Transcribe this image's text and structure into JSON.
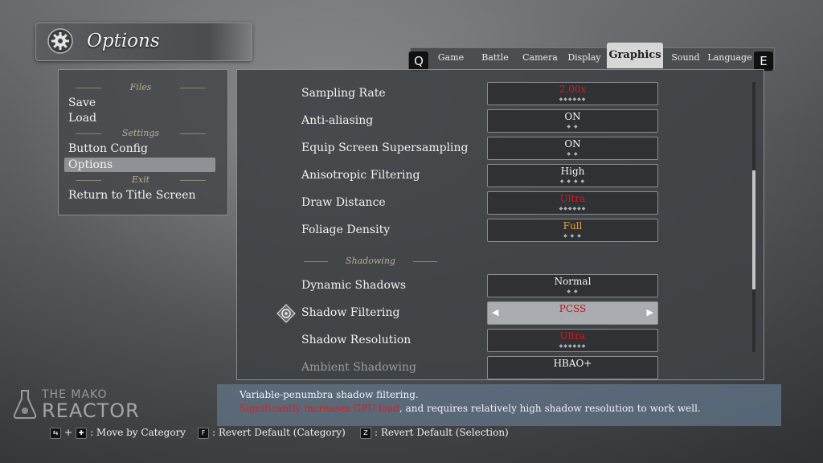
{
  "header": {
    "title": "Options",
    "icon": "gear-icon"
  },
  "tabs": {
    "left_key": "Q",
    "right_key": "E",
    "items": [
      {
        "label": "Game"
      },
      {
        "label": "Battle"
      },
      {
        "label": "Camera"
      },
      {
        "label": "Display"
      },
      {
        "label": "Graphics",
        "active": true
      },
      {
        "label": "Sound"
      },
      {
        "label": "Language"
      }
    ]
  },
  "menu": {
    "sections": [
      "Files",
      "Settings",
      "Exit"
    ],
    "items": [
      "Save",
      "Load",
      "Button Config",
      "Options",
      "Return to Title Screen"
    ],
    "selected": "Options"
  },
  "settings": [
    {
      "label": "Sampling Rate",
      "value": "2.00x",
      "color": "#d21d1d"
    },
    {
      "label": "Anti-aliasing",
      "value": "ON",
      "color": "#f5f5f5"
    },
    {
      "label": "Equip Screen Supersampling",
      "value": "ON",
      "color": "#f5f5f5"
    },
    {
      "label": "Anisotropic Filtering",
      "value": "High",
      "color": "#f5f5f5"
    },
    {
      "label": "Draw Distance",
      "value": "Ultra",
      "color": "#d21d1d"
    },
    {
      "label": "Foliage Density",
      "value": "Full",
      "color": "#e8a23a"
    }
  ],
  "shadowing": {
    "header": "Shadowing",
    "rows": [
      {
        "label": "Dynamic Shadows",
        "value": "Normal"
      },
      {
        "label": "Shadow Filtering",
        "value": "PCSS",
        "selected": true
      },
      {
        "label": "Shadow Resolution",
        "value": "Ultra"
      },
      {
        "label": "Ambient Shadowing",
        "value": "HBAO+",
        "disabled": true
      }
    ]
  },
  "description": {
    "line1": "Variable-penumbra shadow filtering.",
    "line2_warning": "Significantly increases GPU load",
    "line2_rest": ", and requires relatively high shadow resolution to work well."
  },
  "footer": {
    "move": ": Move by Category",
    "revert_category_key": "F",
    "revert_category": ": Revert Default (Category)",
    "revert_selection_key": "Z",
    "revert_selection": ": Revert Default (Selection)"
  },
  "watermark": {
    "line1": "THE MAKO",
    "line2": "REACTOR"
  },
  "colors": {
    "accent_red": "#d21d1d",
    "accent_orange": "#e8a23a",
    "section_gold": "#b9ad8e"
  }
}
